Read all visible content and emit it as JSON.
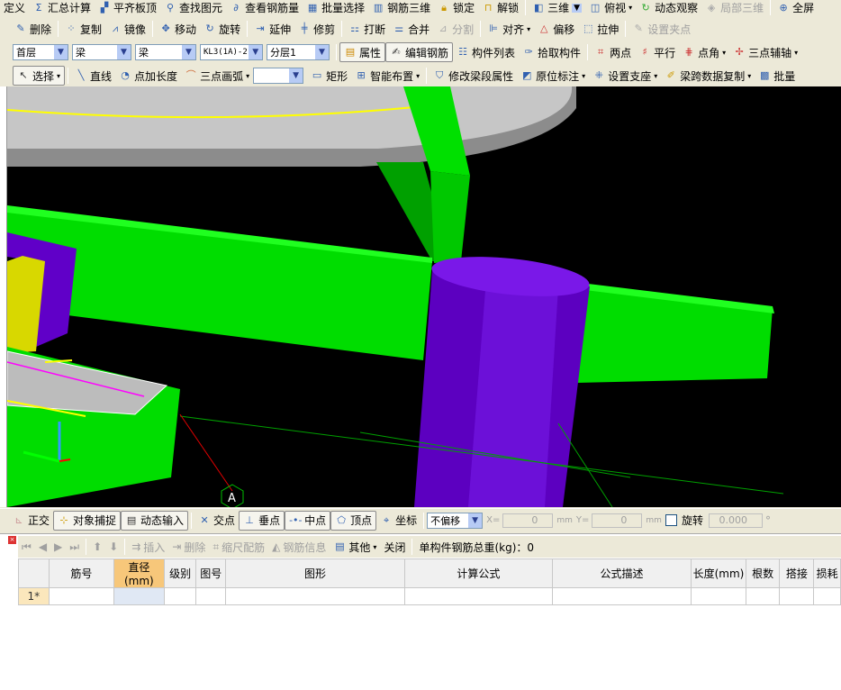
{
  "toolbar_main": [
    "定义",
    "汇总计算",
    "平齐板顶",
    "查找图元",
    "查看钢筋量",
    "批量选择",
    "钢筋三维",
    "锁定",
    "解锁",
    "三维",
    "俯视",
    "动态观察",
    "局部三维",
    "全屏"
  ],
  "toolbar_edit": [
    "删除",
    "复制",
    "镜像",
    "移动",
    "旋转",
    "延伸",
    "修剪",
    "打断",
    "合并",
    "分割",
    "对齐",
    "偏移",
    "拉伸",
    "设置夹点"
  ],
  "toolbar_component": {
    "floor": "首层",
    "type1": "梁",
    "type2": "梁",
    "name": "KL3(1A)-2",
    "layer": "分层1",
    "property": "属性",
    "edit_rebar": "编辑钢筋",
    "component_list": "构件列表",
    "pick": "拾取构件",
    "two_points": "两点",
    "parallel": "平行",
    "point_angle": "点角",
    "three_point_axis": "三点辅轴"
  },
  "toolbar_draw": {
    "select": "选择",
    "line": "直线",
    "point_length": "点加长度",
    "arc": "三点画弧",
    "shape_select": "",
    "rect": "矩形",
    "smart": "智能布置",
    "modify_span": "修改梁段属性",
    "in_situ": "原位标注",
    "support": "设置支座",
    "copy_span": "梁跨数据复制",
    "batch": "批量"
  },
  "viewport": {
    "axis_label": "A",
    "colors": {
      "beam": "#00e000",
      "column": "#6a00d0",
      "slab": "#c0c0c0"
    }
  },
  "status_bar": {
    "ortho": "正交",
    "snap": "对象捕捉",
    "dynamic_input": "动态输入",
    "intersection": "交点",
    "perpendicular": "垂点",
    "midpoint": "中点",
    "vertex": "顶点",
    "coordinate": "坐标",
    "offset": "不偏移",
    "x_label": "X=",
    "x_value": "0",
    "y_label": "Y=",
    "y_value": "0",
    "unit": "mm",
    "rotate": "旋转",
    "rotate_value": "0.000",
    "deg": "°"
  },
  "rebar_panel": {
    "insert": "插入",
    "delete": "删除",
    "scale": "缩尺配筋",
    "info": "钢筋信息",
    "other": "其他",
    "close": "关闭",
    "total_weight": "单构件钢筋总重(kg)：0",
    "columns": [
      "",
      "筋号",
      "直径(mm)",
      "级别",
      "图号",
      "图形",
      "计算公式",
      "公式描述",
      "长度(mm)",
      "根数",
      "搭接",
      "损耗"
    ],
    "rows": [
      [
        "1*",
        "",
        "",
        "",
        "",
        "",
        "",
        "",
        "",
        "",
        "",
        ""
      ]
    ]
  }
}
